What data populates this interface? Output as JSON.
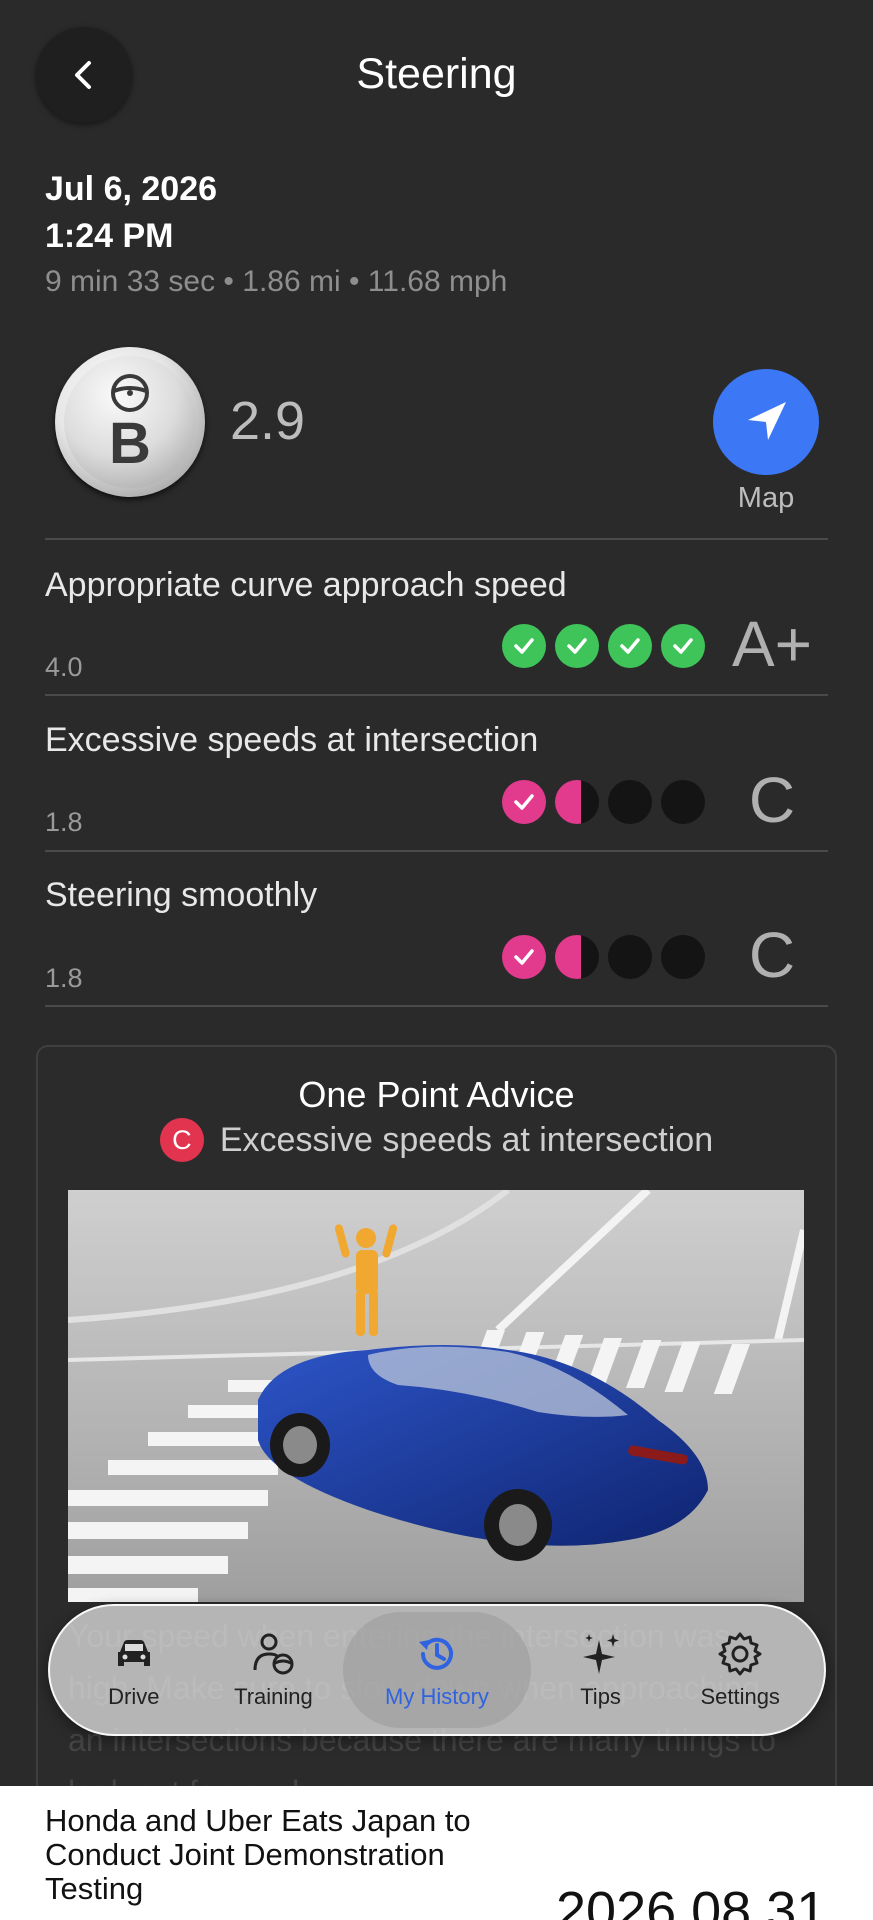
{
  "header": {
    "title": "Steering",
    "back_icon": "chevron-left-icon"
  },
  "trip": {
    "date": "Jul 6, 2026",
    "time": "1:24 PM",
    "meta": "9 min 33 sec • 1.86 mi • 11.68 mph"
  },
  "score": {
    "badge_letter": "B",
    "badge_icon": "steering-wheel-icon",
    "value": "2.9"
  },
  "map": {
    "label": "Map",
    "icon": "navigation-arrow-icon",
    "color": "#3c78f5"
  },
  "metrics": [
    {
      "title": "Appropriate curve approach speed",
      "value": "4.0",
      "grade": "A+",
      "dots": [
        "check-green",
        "check-green",
        "check-green",
        "check-green"
      ]
    },
    {
      "title": "Excessive speeds at intersection",
      "value": "1.8",
      "grade": "C",
      "dots": [
        "check-pink",
        "half-pink",
        "empty",
        "empty"
      ]
    },
    {
      "title": "Steering smoothly",
      "value": "1.8",
      "grade": "C",
      "dots": [
        "check-pink",
        "half-pink",
        "empty",
        "empty"
      ]
    }
  ],
  "advice": {
    "title": "One Point Advice",
    "badge": "C",
    "subtitle": "Excessive speeds at intersection",
    "text": "Your speed when entering the intersection was high. Make sure to slow down when approaching an intersections because there are many things to look out for, such as"
  },
  "nav": {
    "items": [
      {
        "label": "Drive",
        "icon": "car-icon"
      },
      {
        "label": "Training",
        "icon": "driver-training-icon"
      },
      {
        "label": "My History",
        "icon": "history-clock-icon"
      },
      {
        "label": "Tips",
        "icon": "sparkles-icon"
      },
      {
        "label": "Settings",
        "icon": "gear-icon"
      }
    ],
    "active": "My History"
  },
  "footer": {
    "headline": "Honda and Uber Eats Japan to Conduct Joint Demonstration Testing",
    "date": "2026.08.31"
  },
  "colors": {
    "background": "#2a2a2a",
    "good": "#3fc45a",
    "bad": "#e23b8e",
    "accent": "#2f63e0"
  }
}
